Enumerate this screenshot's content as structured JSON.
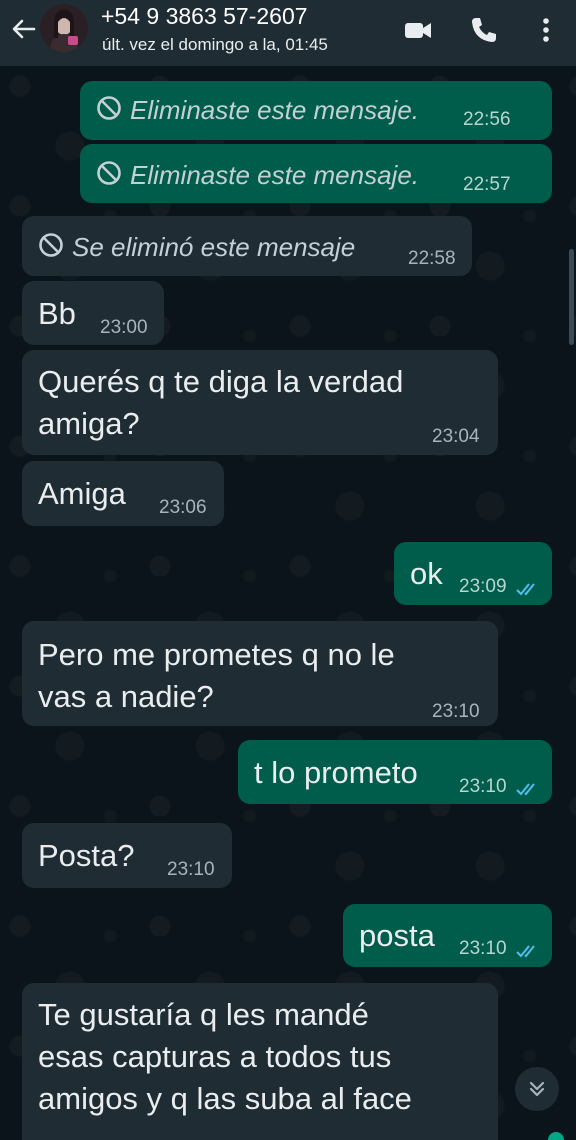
{
  "header": {
    "contact_name": "+54 9 3863 57-2607",
    "status": "últ. vez el domingo a la, 01:45",
    "icons": [
      "back-arrow-icon",
      "video-call-icon",
      "phone-icon",
      "more-vert-icon"
    ]
  },
  "colors": {
    "incoming_bubble": "#1f2c34",
    "outgoing_bubble": "#005c4b",
    "read_ticks": "#53bdeb",
    "background": "#0b141a"
  },
  "messages": [
    {
      "direction": "out",
      "deleted": true,
      "text": "Eliminaste este mensaje.",
      "time": "22:56"
    },
    {
      "direction": "out",
      "deleted": true,
      "text": "Eliminaste este mensaje.",
      "time": "22:57"
    },
    {
      "direction": "in",
      "deleted": true,
      "text": "Se eliminó este mensaje",
      "time": "22:58"
    },
    {
      "direction": "in",
      "text": "Bb",
      "time": "23:00"
    },
    {
      "direction": "in",
      "text_lines": [
        "Querés q te diga la verdad",
        "amiga?"
      ],
      "time": "23:04"
    },
    {
      "direction": "in",
      "text": "Amiga",
      "time": "23:06"
    },
    {
      "direction": "out",
      "text": "ok",
      "time": "23:09",
      "status": "read"
    },
    {
      "direction": "in",
      "text_lines": [
        "Pero me prometes q no le",
        "vas a nadie?"
      ],
      "time": "23:10"
    },
    {
      "direction": "out",
      "text": "t lo prometo",
      "time": "23:10",
      "status": "read"
    },
    {
      "direction": "in",
      "text": "Posta?",
      "time": "23:10"
    },
    {
      "direction": "out",
      "text": "posta",
      "time": "23:10",
      "status": "read"
    },
    {
      "direction": "in",
      "text_lines": [
        "Te gustaría q les mandé",
        "esas capturas a todos tus",
        "amigos y q las suba al face"
      ]
    }
  ]
}
